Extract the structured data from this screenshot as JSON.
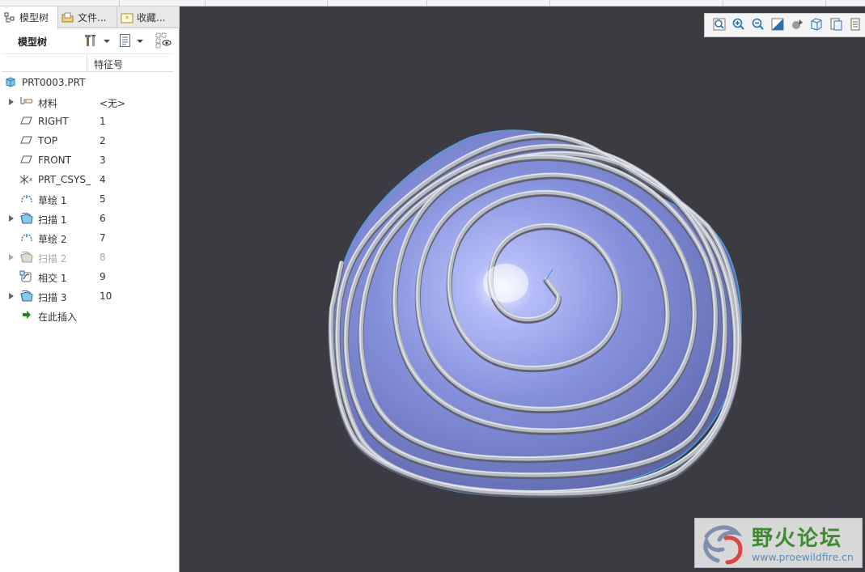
{
  "tabs": [
    {
      "label": "模型树",
      "icon": "model-tree-icon",
      "active": true
    },
    {
      "label": "文件...",
      "icon": "folder-icon",
      "active": false
    },
    {
      "label": "收藏...",
      "icon": "favorites-icon",
      "active": false
    }
  ],
  "toolbar": {
    "title": "模型树",
    "settings_icon": "tools-settings-icon",
    "show_icon": "list-show-icon",
    "filter_icon": "tree-filter-icon"
  },
  "columns": {
    "feature_id": "特征号"
  },
  "tree": {
    "root": {
      "label": "PRT0003.PRT",
      "icon": "part-icon"
    },
    "items": [
      {
        "label": "材料",
        "num": "<无>",
        "icon": "material-icon",
        "expandable": true,
        "dim": false
      },
      {
        "label": "RIGHT",
        "num": "1",
        "icon": "datum-plane-icon",
        "expandable": false,
        "dim": false
      },
      {
        "label": "TOP",
        "num": "2",
        "icon": "datum-plane-icon",
        "expandable": false,
        "dim": false
      },
      {
        "label": "FRONT",
        "num": "3",
        "icon": "datum-plane-icon",
        "expandable": false,
        "dim": false
      },
      {
        "label": "PRT_CSYS_",
        "num": "4",
        "icon": "coordinate-system-icon",
        "expandable": false,
        "dim": false
      },
      {
        "label": "草绘 1",
        "num": "5",
        "icon": "sketch-icon",
        "expandable": false,
        "dim": false
      },
      {
        "label": "扫描 1",
        "num": "6",
        "icon": "sweep-icon",
        "expandable": true,
        "dim": false
      },
      {
        "label": "草绘 2",
        "num": "7",
        "icon": "sketch-icon",
        "expandable": false,
        "dim": false
      },
      {
        "label": "扫描 2",
        "num": "8",
        "icon": "sweep-icon",
        "expandable": true,
        "dim": true
      },
      {
        "label": "相交 1",
        "num": "9",
        "icon": "intersect-icon",
        "expandable": false,
        "dim": false
      },
      {
        "label": "扫描 3",
        "num": "10",
        "icon": "sweep-icon",
        "expandable": true,
        "dim": false
      },
      {
        "label": "在此插入",
        "num": "",
        "icon": "insert-here-arrow-icon",
        "expandable": false,
        "dim": false
      }
    ]
  },
  "view_toolbar": [
    "zoom-fit-icon",
    "zoom-in-icon",
    "zoom-out-icon",
    "repaint-icon",
    "display-style-icon",
    "saved-views-icon",
    "view-manager-icon",
    "more-icon"
  ],
  "watermark": {
    "title": "野火论坛",
    "url": "www.proewildfire.cn"
  },
  "colors": {
    "viewport_bg": "#3b3b41",
    "surface": "#8d99e6",
    "sweep_rib": "#b8bcc4",
    "watermark_green": "#3c8b2e"
  }
}
